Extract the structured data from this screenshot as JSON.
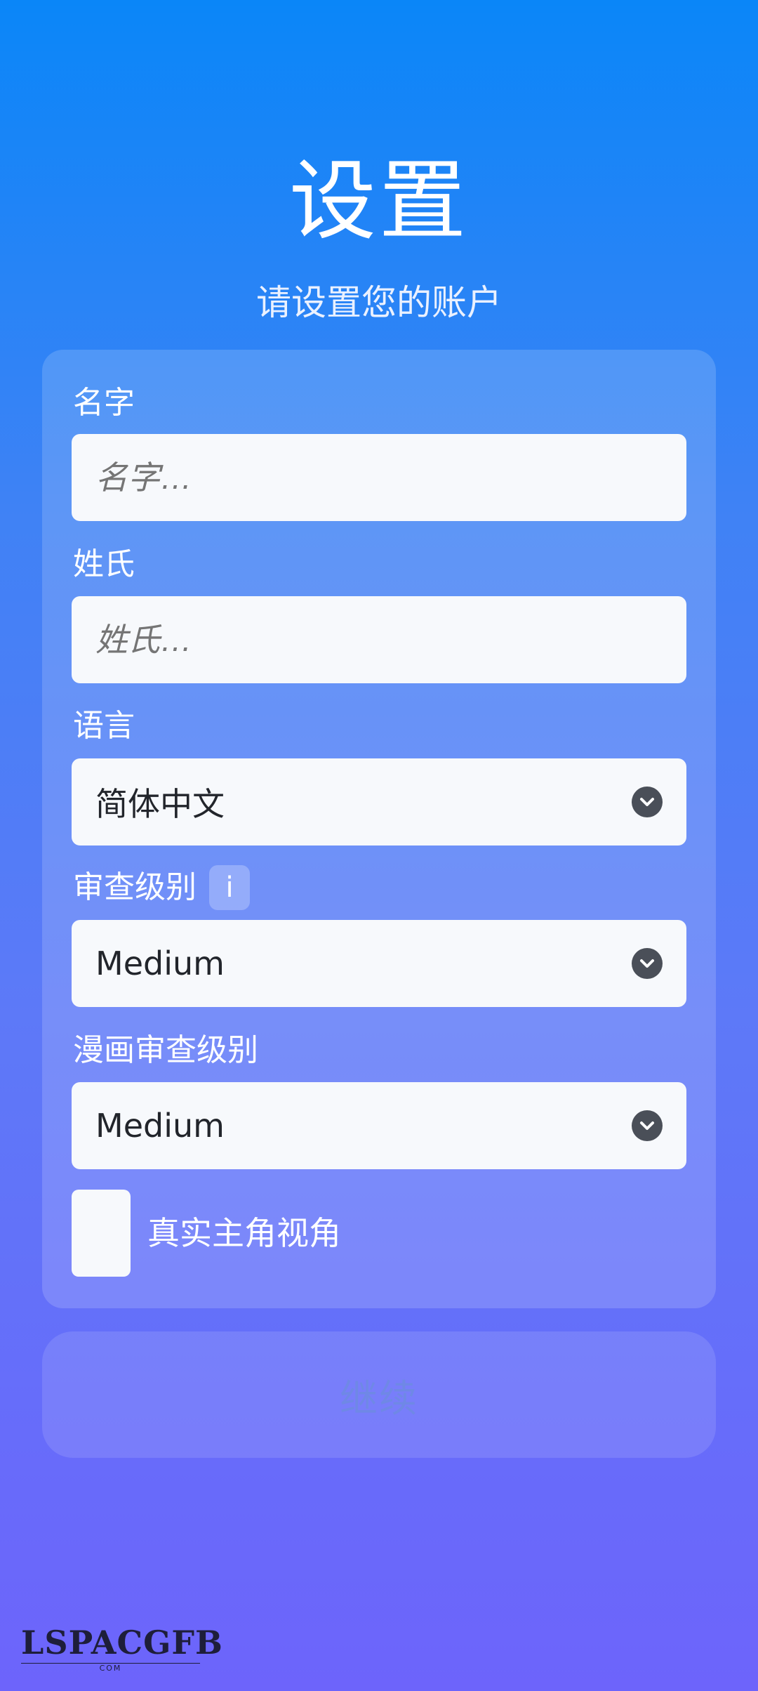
{
  "header": {
    "title": "设置",
    "subtitle": "请设置您的账户"
  },
  "form": {
    "first_name": {
      "label": "名字",
      "placeholder": "名字…",
      "value": ""
    },
    "last_name": {
      "label": "姓氏",
      "placeholder": "姓氏…",
      "value": ""
    },
    "language": {
      "label": "语言",
      "selected": "简体中文",
      "icon": "chevron-down-icon"
    },
    "censorship": {
      "label": "审查级别",
      "info_icon_glyph": "i",
      "selected": "Medium",
      "icon": "chevron-down-icon"
    },
    "comic_censorship": {
      "label": "漫画审查级别",
      "selected": "Medium",
      "icon": "chevron-down-icon"
    },
    "realistic_pov": {
      "label": "真实主角视角",
      "checked": false
    }
  },
  "actions": {
    "continue_label": "继续"
  },
  "watermark": {
    "brand": "LSPACGFB",
    "sub": "COM"
  },
  "colors": {
    "gradient_top": "#0a86f8",
    "gradient_bottom": "#6d64fb",
    "field_bg": "#f7f9fc",
    "chevron_bg": "#4a4f58",
    "button_text": "#6f88e6"
  }
}
